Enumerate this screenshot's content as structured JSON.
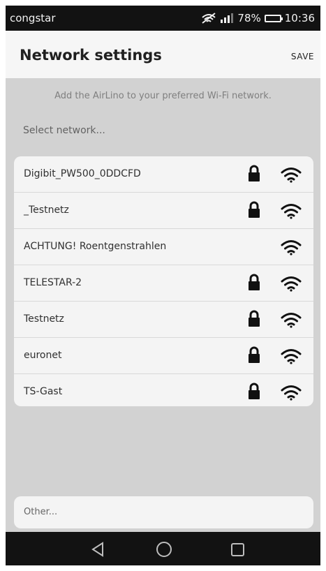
{
  "status_bar": {
    "carrier": "congstar",
    "battery_text": "78%",
    "time": "10:36",
    "battery_level": 0.78
  },
  "header": {
    "title": "Network settings",
    "save_label": "SAVE"
  },
  "hint": "Add the AirLino to your preferred Wi-Fi network.",
  "select_label": "Select network...",
  "networks": [
    {
      "ssid": "Digibit_PW500_0DDCFD",
      "locked": true,
      "signal": 3
    },
    {
      "ssid": "_Testnetz",
      "locked": true,
      "signal": 3
    },
    {
      "ssid": "ACHTUNG! Roentgenstrahlen",
      "locked": false,
      "signal": 3
    },
    {
      "ssid": "TELESTAR-2",
      "locked": true,
      "signal": 3
    },
    {
      "ssid": "Testnetz",
      "locked": true,
      "signal": 3
    },
    {
      "ssid": "euronet",
      "locked": true,
      "signal": 3
    },
    {
      "ssid": "TS-Gast",
      "locked": true,
      "signal": 3
    }
  ],
  "other_label": "Other...",
  "nav": {
    "back_icon": "back-icon",
    "home_icon": "home-icon",
    "recent_icon": "recent-apps-icon"
  },
  "colors": {
    "status_bar": "#121212",
    "app_bar": "#f6f6f6",
    "background": "#d2d2d2",
    "card": "#f4f4f4",
    "icon": "#111111"
  }
}
